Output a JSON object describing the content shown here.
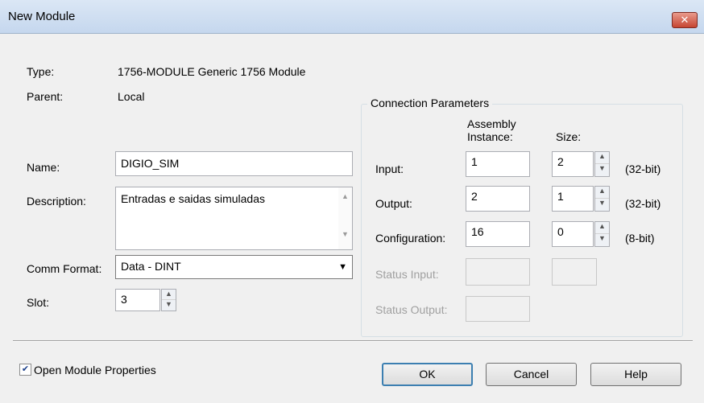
{
  "window": {
    "title": "New Module",
    "close_icon": "close-icon"
  },
  "module": {
    "type_label": "Type:",
    "type_value": "1756-MODULE Generic 1756 Module",
    "parent_label": "Parent:",
    "parent_value": "Local",
    "name_label": "Name:",
    "name_value": "DIGIO_SIM",
    "description_label": "Description:",
    "description_value": "Entradas e saidas simuladas",
    "comm_format_label": "Comm Format:",
    "comm_format_value": "Data - DINT",
    "slot_label": "Slot:",
    "slot_value": "3"
  },
  "connection": {
    "title": "Connection Parameters",
    "col_instance": "Assembly Instance:",
    "col_instance_line1": "Assembly",
    "col_instance_line2": "Instance:",
    "col_size": "Size:",
    "rows": [
      {
        "label": "Input:",
        "instance": "1",
        "size": "2",
        "unit": "(32-bit)",
        "enabled": true
      },
      {
        "label": "Output:",
        "instance": "2",
        "size": "1",
        "unit": "(32-bit)",
        "enabled": true
      },
      {
        "label": "Configuration:",
        "instance": "16",
        "size": "0",
        "unit": "(8-bit)",
        "enabled": true
      },
      {
        "label": "Status Input:",
        "instance": "",
        "size": "",
        "unit": "",
        "enabled": false
      },
      {
        "label": "Status Output:",
        "instance": "",
        "size": "",
        "unit": "",
        "enabled": false
      }
    ]
  },
  "footer": {
    "open_properties_label": "Open Module Properties",
    "open_properties_checked": true,
    "ok_label": "OK",
    "cancel_label": "Cancel",
    "help_label": "Help"
  }
}
